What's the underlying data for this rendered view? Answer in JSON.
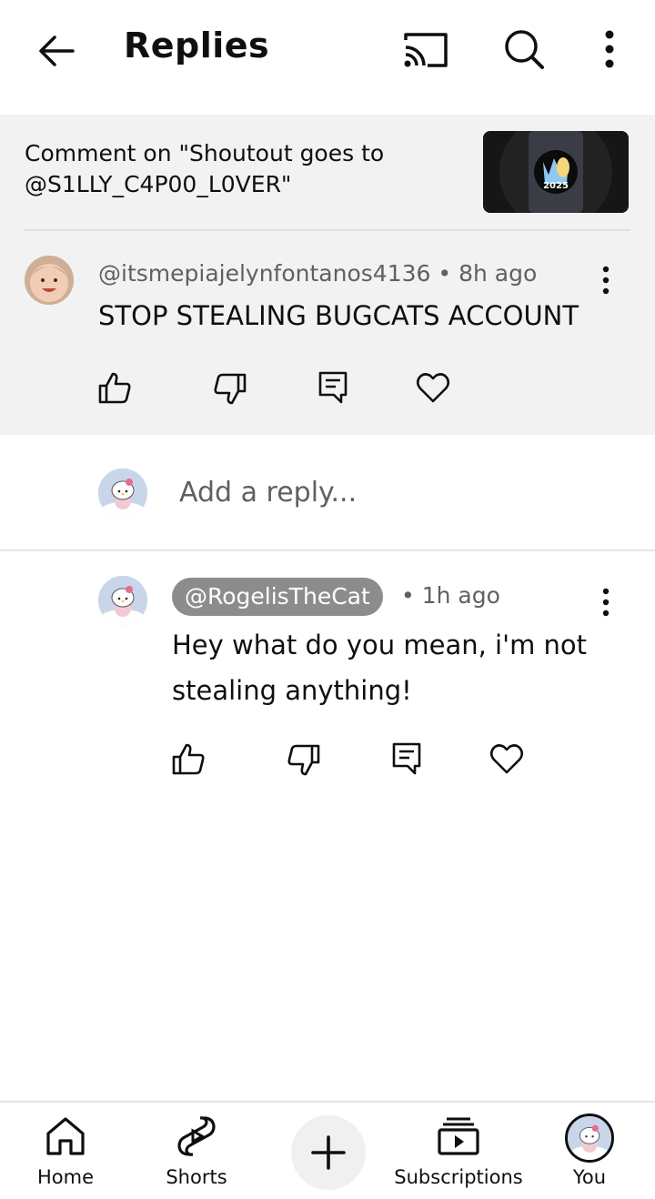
{
  "header": {
    "title": "Replies",
    "icons": {
      "back": "back-arrow-icon",
      "cast": "cast-icon",
      "search": "search-icon",
      "more": "more-vertical-icon"
    }
  },
  "context": {
    "text": "Comment on \"Shoutout goes to @S1LLY_C4P00_L0VER\"",
    "thumbnail_label": "2025"
  },
  "top_comment": {
    "author": "@itsmepiajelynfontanos4136",
    "time": "8h ago",
    "text": "STOP STEALING BUGCATS ACCOUNT"
  },
  "reply_box": {
    "placeholder": "Add a reply..."
  },
  "reply": {
    "author": "@RogelisTheCat",
    "time": "1h ago",
    "text": "Hey what do you mean, i'm not stealing anything!"
  },
  "bottom_nav": {
    "items": [
      {
        "label": "Home",
        "icon": "home-icon"
      },
      {
        "label": "Shorts",
        "icon": "shorts-icon"
      },
      {
        "label": "",
        "icon": "create-plus-icon"
      },
      {
        "label": "Subscriptions",
        "icon": "subscriptions-icon"
      },
      {
        "label": "You",
        "icon": "avatar"
      }
    ]
  }
}
